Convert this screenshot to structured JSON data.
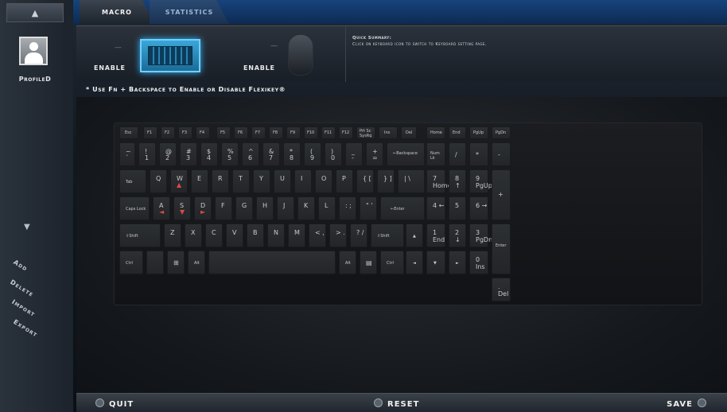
{
  "sidebar": {
    "up_arrow": "▲",
    "profile_label": "ProfileD",
    "down_arrow": "▼",
    "actions": [
      "Add",
      "Delete",
      "Import",
      "Export"
    ]
  },
  "tabs": [
    "MACRO",
    "STATISTICS"
  ],
  "header": {
    "enable_keyboard": "ENABLE",
    "enable_mouse": "ENABLE",
    "quick_summary_title": "Quick Summary:",
    "quick_summary_text": "Click on keyboard icon to switch to Keyboard setting page.",
    "fn_note": "* Use Fn + Backspace to Enable or Disable Flexikey®"
  },
  "keyboard": {
    "row0": [
      "Esc",
      "F1",
      "F2",
      "F3",
      "F4",
      "F5",
      "F6",
      "F7",
      "F8",
      "F9",
      "F10",
      "F11",
      "F12",
      "Prt Sc SysRq",
      "Ins",
      "Del",
      "Home",
      "End",
      "PgUp",
      "PgDn"
    ],
    "row1": [
      [
        "~",
        "`"
      ],
      [
        "!",
        "1"
      ],
      [
        "@",
        "2"
      ],
      [
        "#",
        "3"
      ],
      [
        "$",
        "4"
      ],
      [
        "%",
        "5"
      ],
      [
        "^",
        "6"
      ],
      [
        "&",
        "7"
      ],
      [
        "*",
        "8"
      ],
      [
        "(",
        "9"
      ],
      [
        ")",
        "0"
      ],
      [
        "_",
        "-"
      ],
      [
        "+",
        "="
      ],
      [
        "←Backspace",
        ""
      ],
      [
        "Num Lk",
        ""
      ],
      [
        "/",
        ""
      ],
      [
        "*",
        ""
      ],
      [
        "-",
        ""
      ]
    ],
    "row2": [
      "Tab",
      "Q",
      "W",
      "E",
      "R",
      "T",
      "Y",
      "U",
      "I",
      "O",
      "P",
      "{ [",
      "} ]",
      "| \\",
      "7 Home",
      "8 ↑",
      "9 PgUp",
      "+"
    ],
    "row3": [
      "Caps Lock",
      "A",
      "S",
      "D",
      "F",
      "G",
      "H",
      "J",
      "K",
      "L",
      ": ;",
      "\" '",
      "←Enter",
      "4 ←",
      "5",
      "6 →"
    ],
    "row4": [
      "⇧Shift",
      "Z",
      "X",
      "C",
      "V",
      "B",
      "N",
      "M",
      "< ,",
      "> .",
      "? /",
      "⇧Shift",
      "▲",
      "1 End",
      "2 ↓",
      "3 PgDn",
      "Enter"
    ],
    "row5": [
      "Ctrl",
      "",
      "⊞",
      "Alt",
      "",
      "Alt",
      "▤",
      "Ctrl",
      "◄",
      "▼",
      "►",
      "0 Ins",
      ". Del"
    ]
  },
  "bottom": {
    "quit": "QUIT",
    "reset": "RESET",
    "save": "SAVE"
  }
}
